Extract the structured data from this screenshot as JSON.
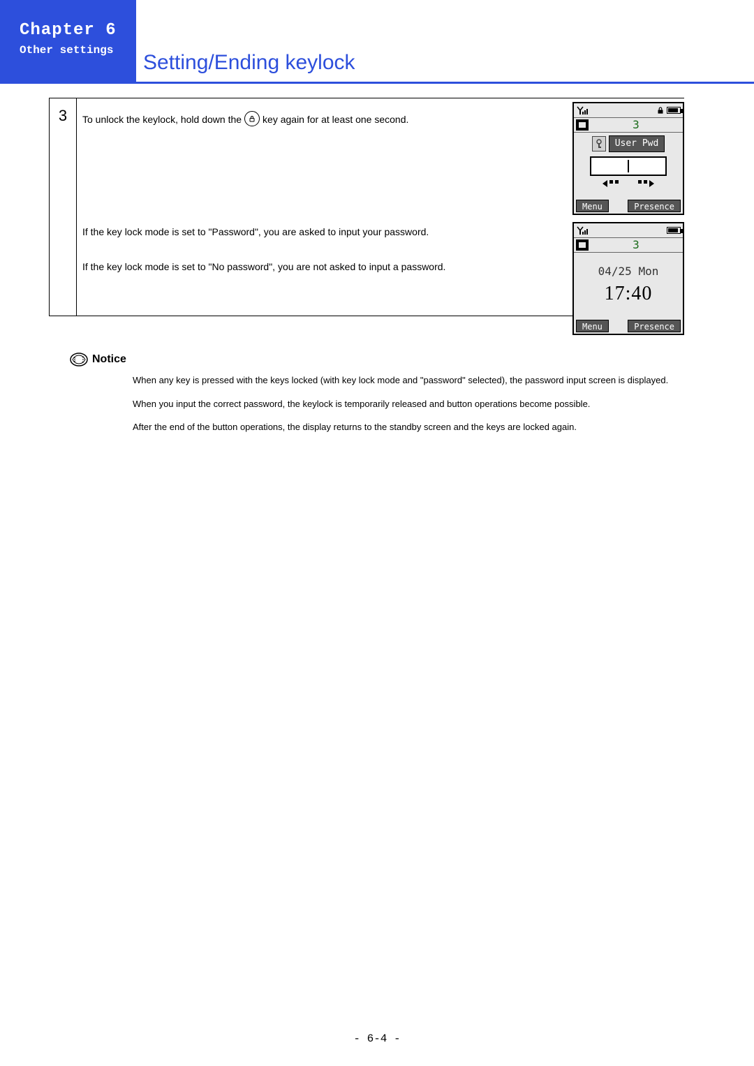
{
  "header": {
    "chapter": "Chapter 6",
    "subchapter": "Other settings",
    "title": "Setting/Ending keylock"
  },
  "step": {
    "number": "3",
    "line1a": "To unlock the keylock, hold down the",
    "line1b": "key again for at least one second.",
    "keyglyph": "⏻",
    "line2": "If the key lock mode is set to \"Password\", you are asked to input your password.",
    "line3": "If the key lock mode is set to \"No password\", you are not asked to input a password."
  },
  "screen1": {
    "channel": "3",
    "pwd_label": "User Pwd",
    "softkey_left": "Menu",
    "softkey_right": "Presence"
  },
  "screen2": {
    "channel": "3",
    "date": "04/25 Mon",
    "time": "17:40",
    "softkey_left": "Menu",
    "softkey_right": "Presence"
  },
  "notice": {
    "label": "Notice",
    "p1": "When any key is pressed with the keys locked (with key lock mode and \"password\" selected), the password input screen is displayed.",
    "p2": "When you input the correct password, the keylock is temporarily released and button operations become possible.",
    "p3": "After the end of the button operations, the display returns to the standby screen and the keys are locked again."
  },
  "footer": "- 6-4 -"
}
